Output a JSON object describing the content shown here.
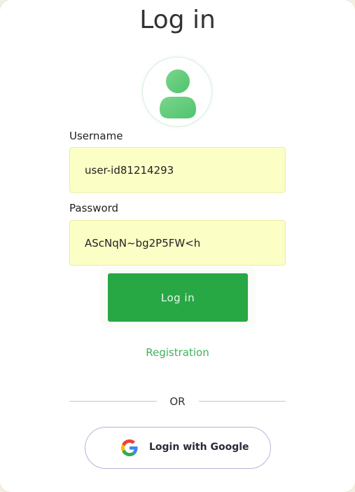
{
  "header": {
    "title": "Log in"
  },
  "avatar": {
    "icon": "user-icon",
    "color": "#5ccb78"
  },
  "form": {
    "username_label": "Username",
    "username_value": "user-id81214293",
    "password_label": "Password",
    "password_value": "AScNqN~bg2P5FW<h",
    "login_label": "Log in",
    "registration_label": "Registration"
  },
  "divider": {
    "text": "OR"
  },
  "google": {
    "label": "Login with Google",
    "icon": "google-icon"
  },
  "colors": {
    "primary": "#28a745",
    "field_background": "#fbffc6",
    "link": "#3cb45a",
    "google_border": "#b8b2d6"
  }
}
